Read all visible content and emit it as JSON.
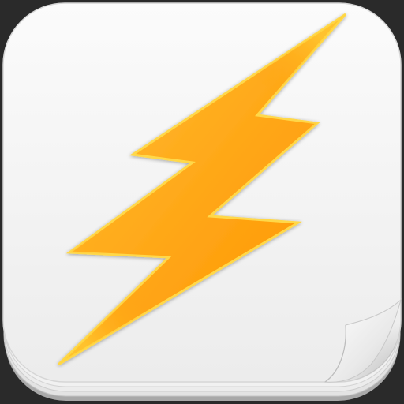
{
  "app_icon": {
    "icon": "lightning-bolt-icon",
    "page_curl": "page-curl-icon",
    "colors": {
      "tile_background": "#f4f4f4",
      "tile_edge": "#d8d8d8",
      "bolt_fill_light": "#ffb21f",
      "bolt_fill_dark": "#ff9a05",
      "bolt_rim": "#ffd84a",
      "outer_background": "#2a2a2a"
    }
  }
}
